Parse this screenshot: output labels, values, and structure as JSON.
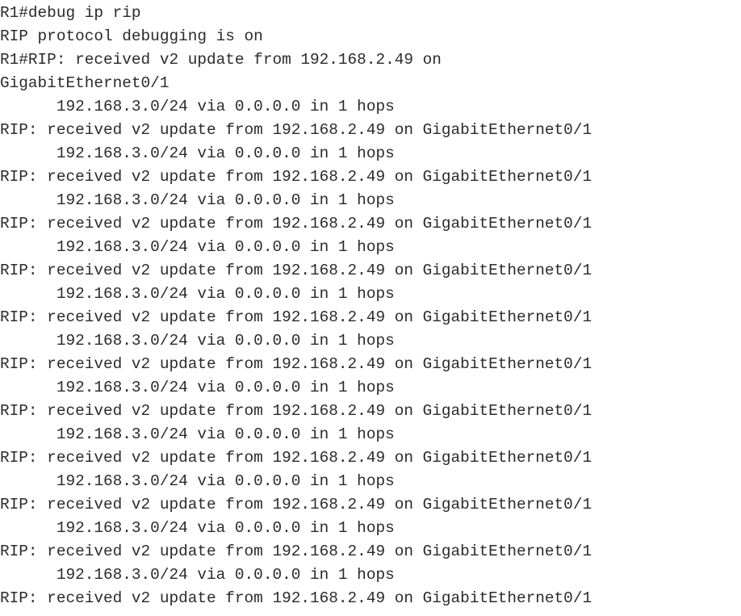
{
  "terminal": {
    "device_prompt": "R1#",
    "background_color": "#ffffff",
    "text_color": "#2b2b2b",
    "font_size_px": 19,
    "line_height_px": 29,
    "visible_line_count": 26,
    "last_line_clipped": true,
    "commands": [
      "debug ip rip"
    ],
    "status_messages": [
      "RIP protocol debugging is on"
    ],
    "protocol": "RIP",
    "rip_version": "v2",
    "neighbor_address": "192.168.2.49",
    "interface": "GigabitEthernet0/1",
    "advertised_network": "192.168.3.0/24",
    "next_hop": "0.0.0.0",
    "metric_hops": "1",
    "lines": [
      "R1#debug ip rip",
      "RIP protocol debugging is on",
      "R1#RIP: received v2 update from 192.168.2.49 on",
      "GigabitEthernet0/1",
      "      192.168.3.0/24 via 0.0.0.0 in 1 hops",
      "RIP: received v2 update from 192.168.2.49 on GigabitEthernet0/1",
      "      192.168.3.0/24 via 0.0.0.0 in 1 hops",
      "RIP: received v2 update from 192.168.2.49 on GigabitEthernet0/1",
      "      192.168.3.0/24 via 0.0.0.0 in 1 hops",
      "RIP: received v2 update from 192.168.2.49 on GigabitEthernet0/1",
      "      192.168.3.0/24 via 0.0.0.0 in 1 hops",
      "RIP: received v2 update from 192.168.2.49 on GigabitEthernet0/1",
      "      192.168.3.0/24 via 0.0.0.0 in 1 hops",
      "RIP: received v2 update from 192.168.2.49 on GigabitEthernet0/1",
      "      192.168.3.0/24 via 0.0.0.0 in 1 hops",
      "RIP: received v2 update from 192.168.2.49 on GigabitEthernet0/1",
      "      192.168.3.0/24 via 0.0.0.0 in 1 hops",
      "RIP: received v2 update from 192.168.2.49 on GigabitEthernet0/1",
      "      192.168.3.0/24 via 0.0.0.0 in 1 hops",
      "RIP: received v2 update from 192.168.2.49 on GigabitEthernet0/1",
      "      192.168.3.0/24 via 0.0.0.0 in 1 hops",
      "RIP: received v2 update from 192.168.2.49 on GigabitEthernet0/1",
      "      192.168.3.0/24 via 0.0.0.0 in 1 hops",
      "RIP: received v2 update from 192.168.2.49 on GigabitEthernet0/1",
      "      192.168.3.0/24 via 0.0.0.0 in 1 hops",
      "RIP: received v2 update from 192.168.2.49 on GigabitEthernet0/1"
    ]
  }
}
